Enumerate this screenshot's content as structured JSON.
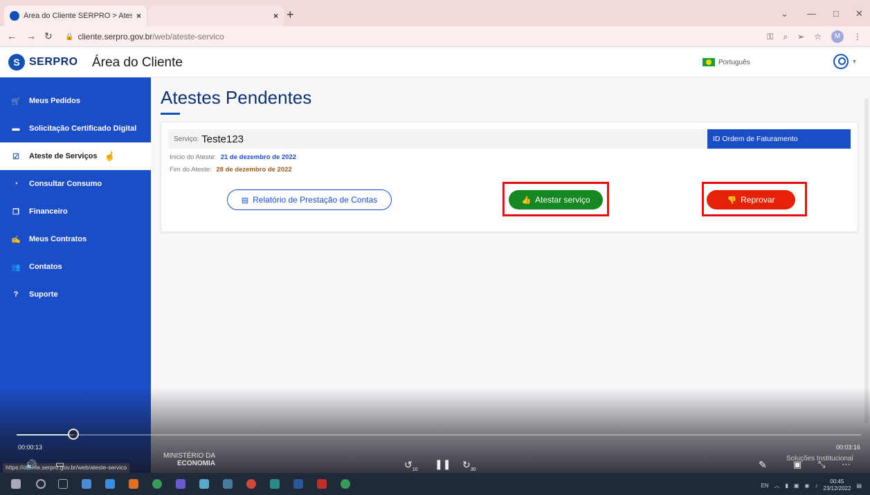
{
  "browser": {
    "active_tab_title": "Área do Cliente SERPRO > Ateste",
    "tab_close": "×",
    "tab2_close": "×",
    "new_tab": "+",
    "url_host": "cliente.serpro.gov.br",
    "url_path": "/web/ateste-servico",
    "profile_initial": "M"
  },
  "header": {
    "logo_text": "SERPRO",
    "logo_glyph": "S",
    "title": "Área do Cliente",
    "language": "Português"
  },
  "sidebar": {
    "items": [
      {
        "label": "Meus Pedidos",
        "icon": "cart-icon"
      },
      {
        "label": "Solicitação Certificado Digital",
        "icon": "certificate-icon"
      },
      {
        "label": "Ateste de Serviços",
        "icon": "checkbox-icon",
        "active": true
      },
      {
        "label": "Consultar Consumo",
        "icon": "gauge-icon"
      },
      {
        "label": "Financeiro",
        "icon": "copy-icon"
      },
      {
        "label": "Meus Contratos",
        "icon": "contract-icon"
      },
      {
        "label": "Contatos",
        "icon": "users-icon"
      },
      {
        "label": "Suporte",
        "icon": "help-icon"
      }
    ]
  },
  "main": {
    "page_title": "Atestes Pendentes",
    "card": {
      "service_label": "Serviço:",
      "service_value": "Teste123",
      "id_header": "ID Ordem de Faturamento",
      "start_label": "Inicio do Ateste:",
      "start_value": "21 de dezembro de 2022",
      "end_label": "Fim do Ateste:",
      "end_value": "28 de dezembro de 2022",
      "report_button": "Relatório de Prestação de Contas",
      "approve_button": "Atestar serviço",
      "reject_button": "Reprovar"
    },
    "accent_color": "#1b4ec6",
    "approve_color": "#168821",
    "reject_color": "#e52207"
  },
  "video": {
    "current_time": "00:00:13",
    "total_time": "00:03:16",
    "progress_fraction": 0.067,
    "footer_line1": "MINISTÉRIO DA",
    "footer_line2": "ECONOMIA",
    "footer_right": "Soluções   Institucional",
    "status_url": "https://cliente.serpro.gov.br/web/ateste-servico",
    "skip_back": "10",
    "skip_forward": "30"
  },
  "taskbar": {
    "lang": "EN",
    "time": "00:45",
    "date": "23/12/2022"
  }
}
